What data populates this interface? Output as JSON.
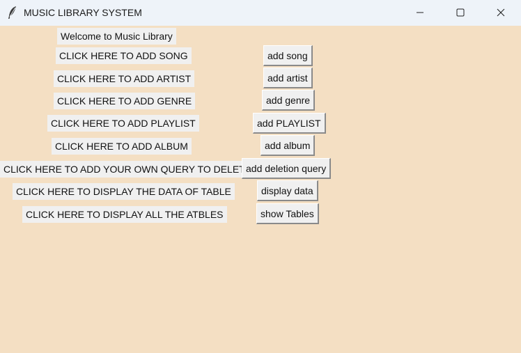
{
  "window": {
    "title": "MUSIC LIBRARY SYSTEM",
    "icon": "feather-icon",
    "controls": [
      "minimize-icon",
      "maximize-icon",
      "close-icon"
    ],
    "background_color": "#f4dfc3"
  },
  "welcome": "Welcome to Music Library",
  "rows": [
    {
      "label": "CLICK HERE TO ADD SONG",
      "button": "add song"
    },
    {
      "label": "CLICK HERE TO ADD ARTIST",
      "button": "add artist"
    },
    {
      "label": "CLICK HERE TO ADD GENRE",
      "button": "add genre"
    },
    {
      "label": "CLICK HERE TO ADD PLAYLIST",
      "button": "add PLAYLIST"
    },
    {
      "label": "CLICK HERE TO ADD ALBUM",
      "button": "add album"
    },
    {
      "label": "CLICK HERE TO ADD YOUR OWN QUERY TO DELETE",
      "button": "add deletion query"
    },
    {
      "label": "CLICK HERE TO DISPLAY THE DATA OF TABLE",
      "button": "display data"
    },
    {
      "label": "CLICK HERE TO DISPLAY ALL THE ATBLES",
      "button": "show Tables"
    }
  ]
}
